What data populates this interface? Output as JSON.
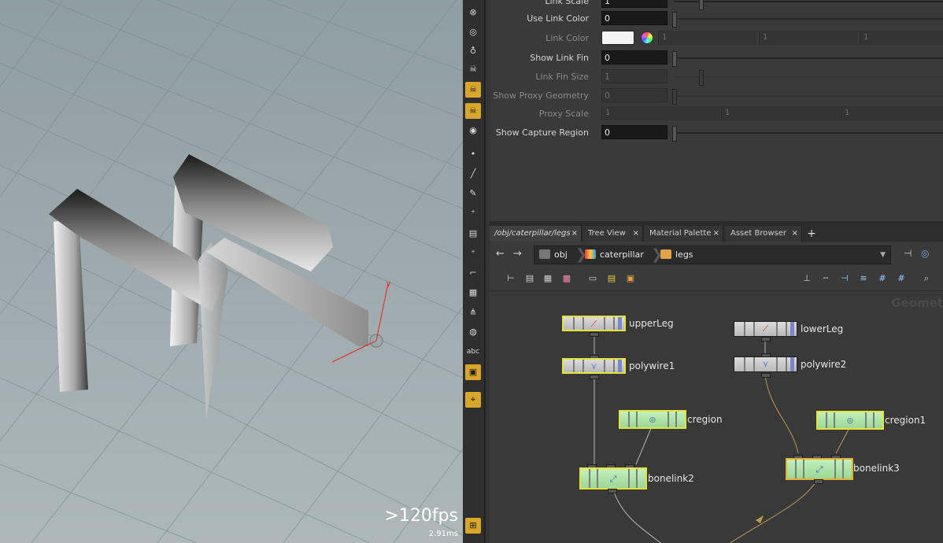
{
  "viewport": {
    "fps": ">120fps",
    "frame_time": "2.91ms",
    "axis_label": "y"
  },
  "toolbar": {
    "icons": [
      "handle-icon",
      "light-icon",
      "bulb-icon",
      "skeleton-icon",
      "bone-icon",
      "capture-icon",
      "eye-icon",
      "point-icon",
      "brush-icon",
      "paint-icon",
      "rig-icon",
      "stack-icon",
      "layer-icon",
      "curve-icon",
      "lattice-icon",
      "joint-icon",
      "disk-icon",
      "abc-icon",
      "image-icon",
      "pin-icon",
      "grid-icon"
    ]
  },
  "params": {
    "link_scale": {
      "label": "Link Scale",
      "value": "1"
    },
    "use_link_color": {
      "label": "Use Link Color",
      "value": "0"
    },
    "link_color": {
      "label": "Link Color",
      "v1": "1",
      "v2": "1",
      "v3": "1",
      "swatch": "#f4f4f4"
    },
    "show_link_fin": {
      "label": "Show Link Fin",
      "value": "0"
    },
    "link_fin_size": {
      "label": "Link Fin Size",
      "value": "1"
    },
    "show_proxy_geometry": {
      "label": "Show Proxy Geometry",
      "value": "0"
    },
    "proxy_scale": {
      "label": "Proxy Scale",
      "v1": "1",
      "v2": "1",
      "v3": "1"
    },
    "show_capture_region": {
      "label": "Show Capture Region",
      "value": "0"
    }
  },
  "tabs": [
    {
      "label": "/obj/caterpillar/legs",
      "close": "×"
    },
    {
      "label": "Tree View",
      "close": "×"
    },
    {
      "label": "Material Palette",
      "close": "×"
    },
    {
      "label": "Asset Browser",
      "close": "×"
    }
  ],
  "tab_add": "+",
  "path": {
    "back": "←",
    "forward": "→",
    "crumbs": [
      "obj",
      "caterpillar",
      "legs"
    ]
  },
  "network": {
    "context_label": "Geomet",
    "nodes": {
      "upperLeg": "upperLeg",
      "polywire1": "polywire1",
      "lowerLeg": "lowerLeg",
      "polywire2": "polywire2",
      "cregion": "cregion",
      "cregion1": "cregion1",
      "bonelink2": "bonelink2",
      "bonelink3": "bonelink3"
    }
  },
  "colors": {
    "accent": "#d8a62b",
    "selection": "#e6e23a",
    "node_green": "#b1e6aa",
    "node_gray": "#cfcfcf"
  }
}
